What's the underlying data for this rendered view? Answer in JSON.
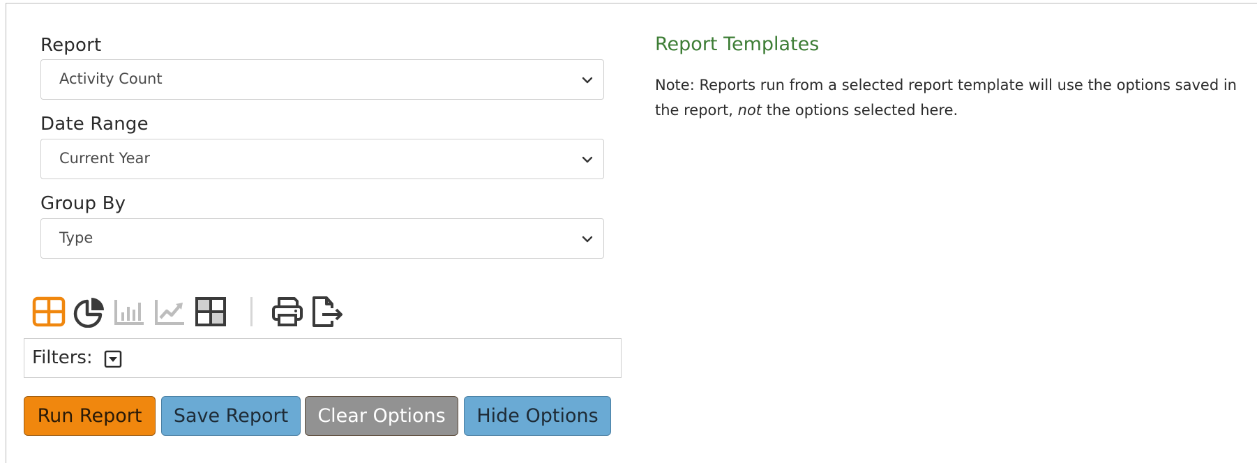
{
  "fields": {
    "report": {
      "label": "Report",
      "value": "Activity Count"
    },
    "date_range": {
      "label": "Date Range",
      "value": "Current Year"
    },
    "group_by": {
      "label": "Group By",
      "value": "Type"
    }
  },
  "toolbar": {
    "icons": [
      "table-icon",
      "pie-chart-icon",
      "bar-chart-icon",
      "line-chart-icon",
      "pivot-grid-icon",
      "print-icon",
      "export-icon"
    ],
    "active_color": "#f0870e",
    "dark_color": "#3a3a3a",
    "light_color": "#bdbdbd"
  },
  "filters": {
    "label": "Filters:"
  },
  "buttons": {
    "run": "Run Report",
    "save": "Save Report",
    "clear": "Clear Options",
    "hide": "Hide Options"
  },
  "templates": {
    "heading": "Report Templates",
    "note_before": "Note: Reports run from a selected report template will use the options saved in the report, ",
    "note_emphasis": "not",
    "note_after": " the options selected here."
  },
  "colors": {
    "orange": "#f0870e",
    "blue": "#6aaad4",
    "gray": "#929292",
    "green": "#3d7d35"
  }
}
